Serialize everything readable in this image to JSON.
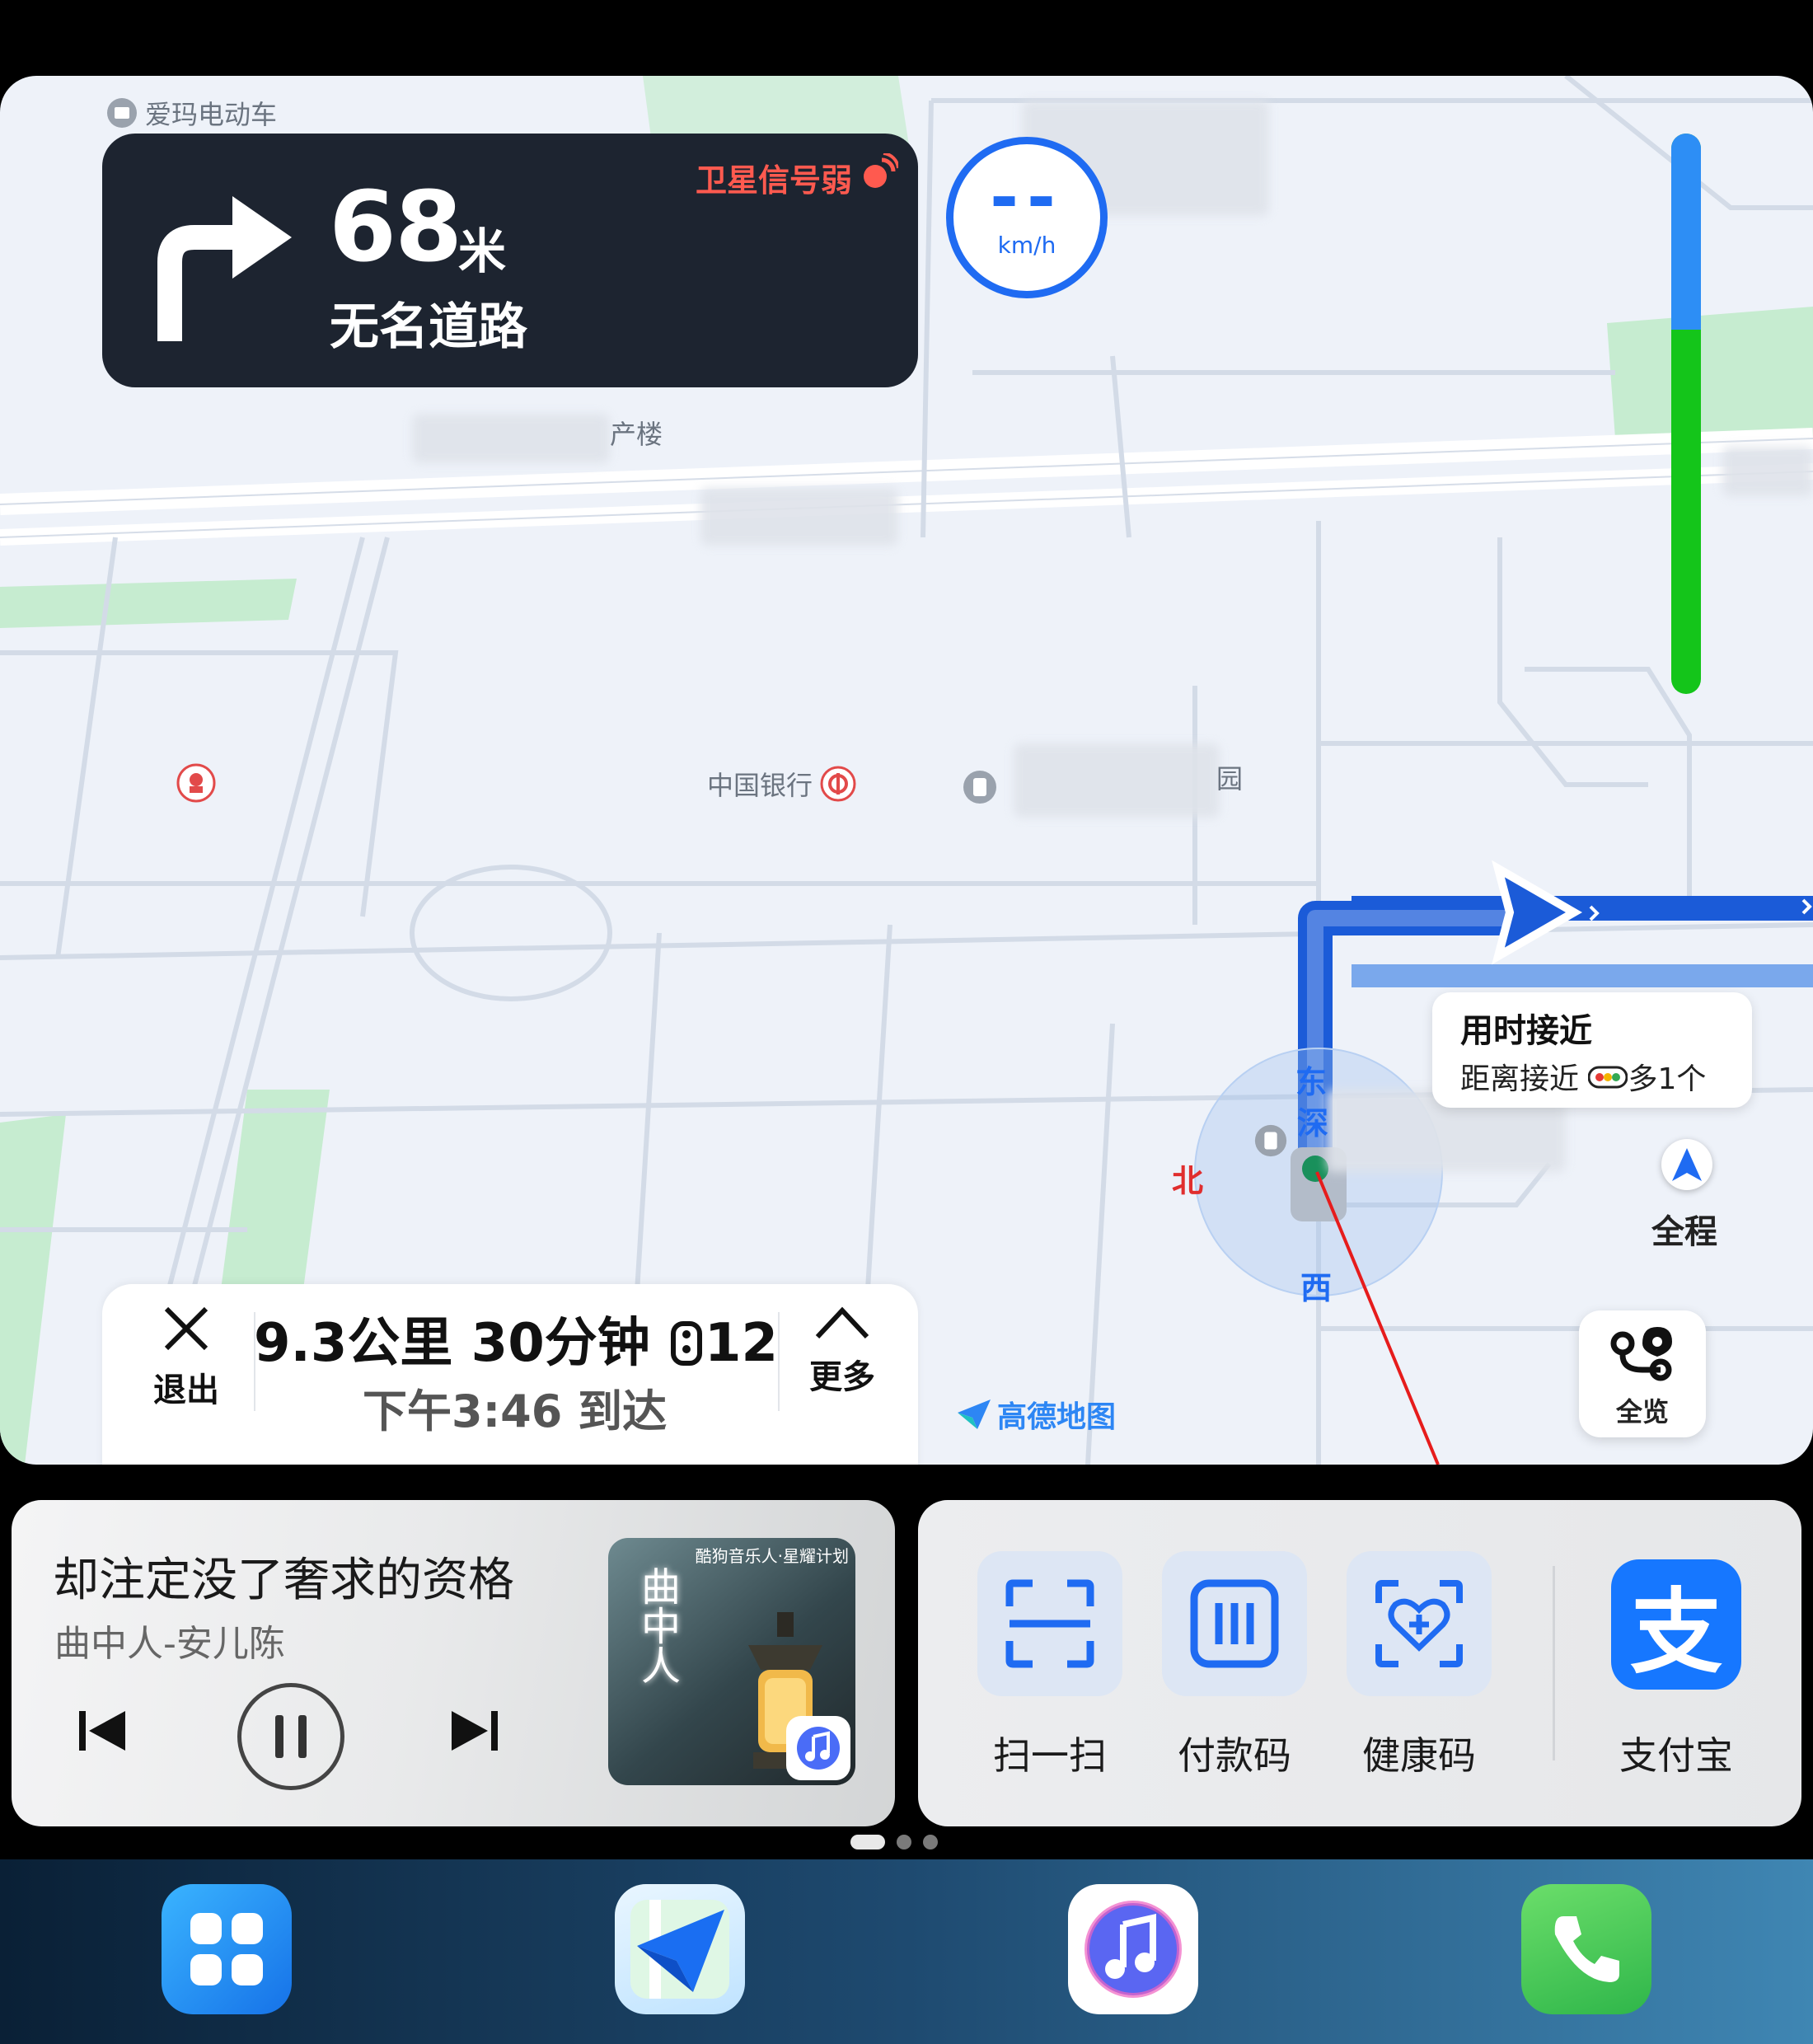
{
  "map": {
    "poi_top_left": "爱玛电动车",
    "poi_building_suffix": "产楼",
    "poi_bank": "中国银行",
    "poi_park_suffix": "园",
    "compass_north": "北",
    "compass_east": "东",
    "compass_west": "西",
    "compass_south": "深",
    "logo": "高德地图"
  },
  "navigation": {
    "distance": "68",
    "distance_unit": "米",
    "road_name": "无名道路",
    "gps_warning": "卫星信号弱",
    "turn_direction": "turn-right-icon"
  },
  "speed": {
    "value": "--",
    "unit": "km/h"
  },
  "route_progress": {
    "completed_fraction": 0.35,
    "label": "全程"
  },
  "route_bubble": {
    "title": "用时接近",
    "subtitle": "距离接近 ",
    "lights": "多1个"
  },
  "overview": {
    "label": "全览"
  },
  "trip": {
    "exit_label": "退出",
    "distance": "9.3公里",
    "duration": "30分钟",
    "traffic_lights": "12",
    "arrival": "下午3:46 到达",
    "more_label": "更多"
  },
  "music": {
    "title": "却注定没了奢求的资格",
    "artist": "曲中人-安儿陈",
    "album_label": "酷狗音乐人·星耀计划",
    "album_title": "曲中人",
    "state": "playing"
  },
  "payments": {
    "scan_label": "扫一扫",
    "pay_code_label": "付款码",
    "health_code_label": "健康码",
    "alipay_label": "支付宝",
    "alipay_glyph": "支"
  },
  "pager": {
    "pages": 3,
    "current": 1
  },
  "dock": [
    "app-grid-icon",
    "amap-icon",
    "music-icon",
    "phone-icon"
  ],
  "colors": {
    "accent_blue": "#1f6bf2",
    "route_green": "#14c51a",
    "warning_red": "#ff5a4f",
    "alipay_blue": "#1677ff",
    "nav_card_bg": "#1d2430"
  }
}
